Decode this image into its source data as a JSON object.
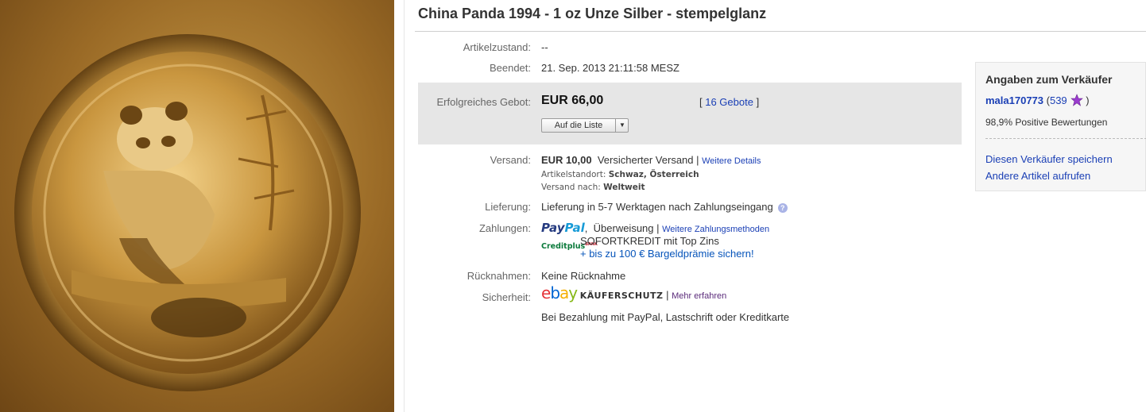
{
  "title": "China Panda 1994 - 1 oz Unze Silber - stempelglanz",
  "condition": {
    "label": "Artikelzustand:",
    "value": "--"
  },
  "ended": {
    "label": "Beendet:",
    "value": "21. Sep. 2013  21:11:58 MESZ"
  },
  "bid": {
    "label": "Erfolgreiches Gebot:",
    "price": "EUR 66,00",
    "bids_open": "[ ",
    "bids_link": "16 Gebote",
    "bids_close": " ]",
    "watch_button": "Auf die Liste"
  },
  "shipping": {
    "label": "Versand:",
    "cost": "EUR 10,00",
    "service": "Versicherter Versand",
    "sep": " | ",
    "details_link": "Weitere Details",
    "location_label": "Artikelstandort:",
    "location_value": "Schwaz, Österreich",
    "to_label": "Versand nach:",
    "to_value": "Weltweit"
  },
  "delivery": {
    "label": "Lieferung:",
    "value": "Lieferung in 5-7 Werktagen nach Zahlungseingang"
  },
  "payments": {
    "label": "Zahlungen:",
    "paypal_a": "Pay",
    "paypal_b": "Pal",
    "transfer": "Überweisung",
    "sep": " | ",
    "more_link": "Weitere Zahlungsmethoden",
    "creditplus_logo": "Creditplus",
    "creditplus_bank": "BANK",
    "sofort": "SOFORTKREDIT mit Top Zins",
    "bonus_link": "+ bis zu 100 € Bargeldprämie sichern!"
  },
  "returns": {
    "label": "Rücknahmen:",
    "value": "Keine Rücknahme"
  },
  "security": {
    "label": "Sicherheit:",
    "ebay_e": "e",
    "ebay_b": "b",
    "ebay_a": "a",
    "ebay_y": "y",
    "protection": "KÄUFERSCHUTZ",
    "sep": " | ",
    "more_link": "Mehr erfahren",
    "note": "Bei Bezahlung mit PayPal, Lastschrift oder Kreditkarte"
  },
  "seller": {
    "heading": "Angaben zum Verkäufer",
    "username": "mala170773",
    "score_open": " (",
    "score": "539",
    "score_close": " )",
    "positive": "98,9% Positive Bewertungen",
    "save_link": "Diesen Verkäufer speichern",
    "other_link": "Andere Artikel aufrufen"
  },
  "colors": {
    "bid_box": "#e6e6e6",
    "link": "#1a3fb5",
    "seller_panel": "#f6f6f6"
  },
  "icons": [
    "help-icon",
    "star-icon",
    "dropdown-arrow-icon",
    "paypal-logo",
    "ebay-logo",
    "creditplus-logo"
  ]
}
